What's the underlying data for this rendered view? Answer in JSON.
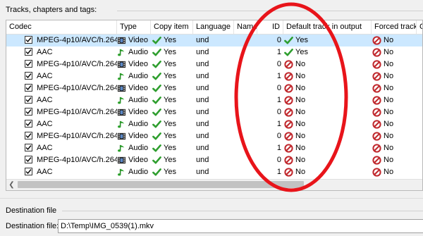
{
  "section_title": "Tracks, chapters and tags:",
  "columns": [
    "Codec",
    "Type",
    "Copy item",
    "Language",
    "Name",
    "ID",
    "Default track in output",
    "Forced track",
    "C"
  ],
  "rows": [
    {
      "codec": "MPEG-4p10/AVC/h.264",
      "type": "Video",
      "copy": "Yes",
      "language": "und",
      "id": "0",
      "default": "Yes",
      "default_yes": true,
      "forced": "No",
      "selected": true
    },
    {
      "codec": "AAC",
      "type": "Audio",
      "copy": "Yes",
      "language": "und",
      "id": "1",
      "default": "Yes",
      "default_yes": true,
      "forced": "No",
      "selected": false
    },
    {
      "codec": "MPEG-4p10/AVC/h.264",
      "type": "Video",
      "copy": "Yes",
      "language": "und",
      "id": "0",
      "default": "No",
      "default_yes": false,
      "forced": "No",
      "selected": false
    },
    {
      "codec": "AAC",
      "type": "Audio",
      "copy": "Yes",
      "language": "und",
      "id": "1",
      "default": "No",
      "default_yes": false,
      "forced": "No",
      "selected": false
    },
    {
      "codec": "MPEG-4p10/AVC/h.264",
      "type": "Video",
      "copy": "Yes",
      "language": "und",
      "id": "0",
      "default": "No",
      "default_yes": false,
      "forced": "No",
      "selected": false
    },
    {
      "codec": "AAC",
      "type": "Audio",
      "copy": "Yes",
      "language": "und",
      "id": "1",
      "default": "No",
      "default_yes": false,
      "forced": "No",
      "selected": false
    },
    {
      "codec": "MPEG-4p10/AVC/h.264",
      "type": "Video",
      "copy": "Yes",
      "language": "und",
      "id": "0",
      "default": "No",
      "default_yes": false,
      "forced": "No",
      "selected": false
    },
    {
      "codec": "AAC",
      "type": "Audio",
      "copy": "Yes",
      "language": "und",
      "id": "1",
      "default": "No",
      "default_yes": false,
      "forced": "No",
      "selected": false
    },
    {
      "codec": "MPEG-4p10/AVC/h.264",
      "type": "Video",
      "copy": "Yes",
      "language": "und",
      "id": "0",
      "default": "No",
      "default_yes": false,
      "forced": "No",
      "selected": false
    },
    {
      "codec": "AAC",
      "type": "Audio",
      "copy": "Yes",
      "language": "und",
      "id": "1",
      "default": "No",
      "default_yes": false,
      "forced": "No",
      "selected": false
    },
    {
      "codec": "MPEG-4p10/AVC/h.264",
      "type": "Video",
      "copy": "Yes",
      "language": "und",
      "id": "0",
      "default": "No",
      "default_yes": false,
      "forced": "No",
      "selected": false
    },
    {
      "codec": "AAC",
      "type": "Audio",
      "copy": "Yes",
      "language": "und",
      "id": "1",
      "default": "No",
      "default_yes": false,
      "forced": "No",
      "selected": false
    }
  ],
  "destination": {
    "section_title": "Destination file",
    "label": "Destination file:",
    "value": "D:\\Temp\\IMG_0539(1).mkv"
  },
  "colors": {
    "selection": "#cce8ff",
    "check_green": "#2e9e2e",
    "no_red": "#c0282d",
    "annotation": "#e8141a"
  },
  "icons": {
    "checkbox": "checkbox-checked-icon",
    "video": "film-icon",
    "audio": "music-note-icon",
    "yes": "green-check-icon",
    "no": "red-no-icon"
  }
}
